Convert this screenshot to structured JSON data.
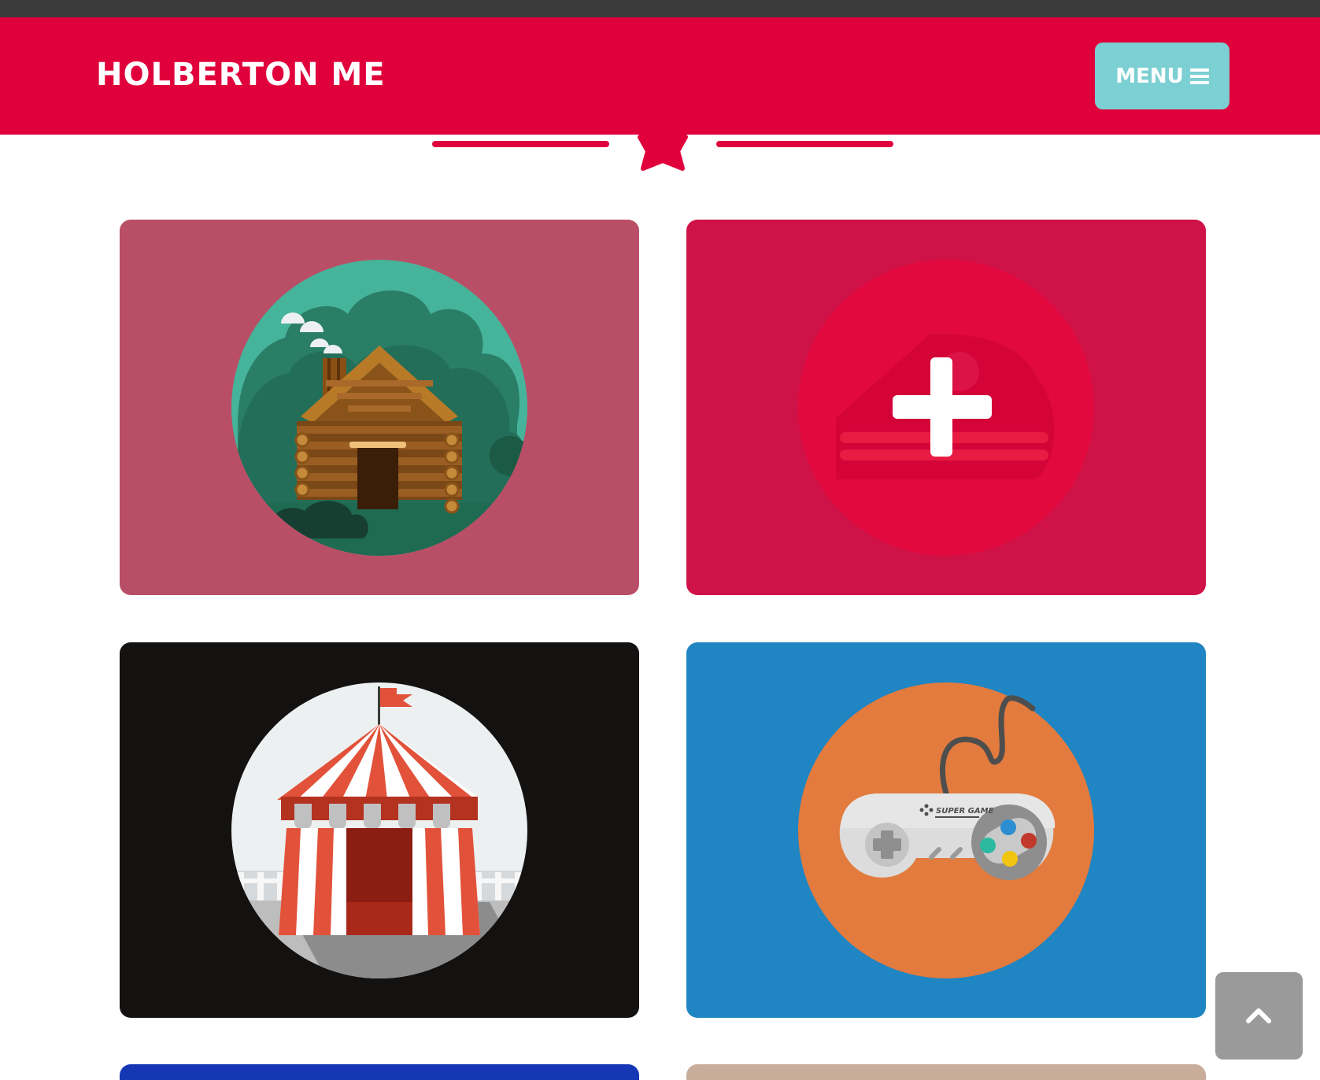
{
  "header": {
    "brand": "HOLBERTON ME",
    "menu_label": "MENU",
    "menu_icon": "bars-icon",
    "background_color": "#e0003c",
    "menu_button_color": "#7ccfd2"
  },
  "divider": {
    "icon": "star-icon",
    "color": "#e0003c"
  },
  "portfolio": {
    "items": [
      {
        "name": "cabin",
        "icon": "log-cabin-icon",
        "card_color": "#b94f66"
      },
      {
        "name": "hovered-item",
        "icon": "plus-icon",
        "card_color": "#cf1247",
        "state": "hover"
      },
      {
        "name": "circus",
        "icon": "circus-tent-icon",
        "card_color": "#141111"
      },
      {
        "name": "game",
        "icon": "game-controller-icon",
        "card_color": "#2085c3",
        "controller_text": "SUPER GAME"
      },
      {
        "name": "item-5",
        "card_color": "#1637b5"
      },
      {
        "name": "item-6",
        "card_color": "#c9ad9b"
      }
    ]
  },
  "back_to_top": {
    "icon": "chevron-up-icon",
    "color": "#9a9a9a"
  }
}
